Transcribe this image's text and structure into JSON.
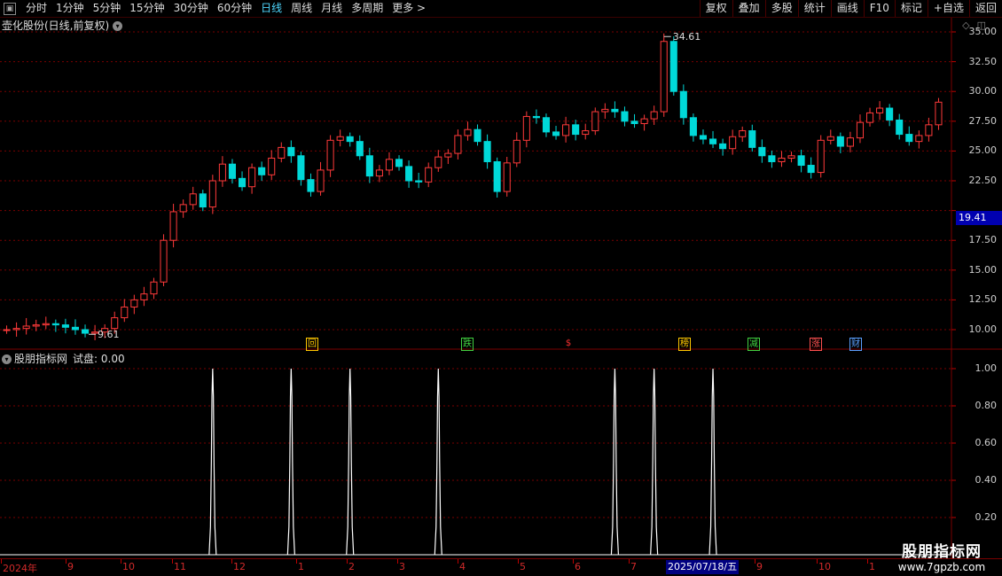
{
  "toolbar": {
    "menu_icon": "window-icon",
    "periods": [
      "分时",
      "1分钟",
      "5分钟",
      "15分钟",
      "30分钟",
      "60分钟",
      "日线",
      "周线",
      "月线",
      "多周期",
      "更多 >"
    ],
    "active_period": "日线",
    "actions": [
      "复权",
      "叠加",
      "多股",
      "统计",
      "画线",
      "F10",
      "标记",
      "+自选",
      "返回"
    ]
  },
  "main_panel": {
    "title": "壶化股份(日线,前复权)",
    "icons": [
      "diamond-icon",
      "panel-toggle-icon"
    ],
    "y_ticks": [
      "35.00",
      "32.50",
      "30.00",
      "27.50",
      "25.00",
      "22.50",
      "19.41",
      "17.50",
      "15.00",
      "12.50",
      "10.00"
    ],
    "current_price": "19.41",
    "high_label": "34.61",
    "low_label": "9.61",
    "markers": [
      {
        "text": "回",
        "color": "#ffc800",
        "border": "#ffc800"
      },
      {
        "text": "跌",
        "color": "#40d040",
        "border": "#40d040"
      },
      {
        "text": "$",
        "color": "#ff3030",
        "border": ""
      },
      {
        "text": "榜",
        "color": "#ffc800",
        "border": "#ffc800"
      },
      {
        "text": "减",
        "color": "#40d040",
        "border": "#40d040"
      },
      {
        "text": "涨",
        "color": "#ff5050",
        "border": "#ff5050"
      },
      {
        "text": "财",
        "color": "#5aa0ff",
        "border": "#5aa0ff"
      }
    ]
  },
  "indicator_panel": {
    "title": "股朋指标网",
    "trial_label": "试盘: 0.00",
    "y_ticks": [
      "1.00",
      "0.80",
      "0.60",
      "0.40",
      "0.20"
    ]
  },
  "date_axis": {
    "labels": [
      "2024年",
      "9",
      "10",
      "11",
      "12",
      "1",
      "2",
      "3",
      "4",
      "5",
      "6",
      "7",
      "9",
      "10",
      "1"
    ],
    "cursor_label": "2025/07/18/五"
  },
  "watermark": {
    "title": "股朋指标网",
    "url": "www.7gpzb.com"
  },
  "colors": {
    "up": "#ff3a3a",
    "down": "#00d8d8",
    "grid": "#7a0000",
    "accent": "#4fd8ff",
    "signal": "#ffffff"
  },
  "chart_data": [
    {
      "type": "candlestick",
      "title": "壶化股份(日线,前复权)",
      "ylim": [
        9.0,
        35.6
      ],
      "y_ticks": [
        10.0,
        12.5,
        15.0,
        17.5,
        20.0,
        22.5,
        25.0,
        27.5,
        30.0,
        32.5,
        35.0
      ],
      "series": [
        {
          "close": [
            10.0,
            10.1,
            10.3,
            10.4,
            10.5,
            10.4,
            10.2,
            10.0,
            9.7,
            9.8,
            10.1,
            11.0,
            11.9,
            12.5,
            13.0,
            14.0,
            17.5,
            19.9,
            20.5,
            21.4,
            20.3,
            22.5,
            23.9,
            22.7,
            22.0,
            23.6,
            23.0,
            24.4,
            25.3,
            24.6,
            22.6,
            21.6,
            23.4,
            25.9,
            26.2,
            25.8,
            24.6,
            22.9,
            23.4,
            24.3,
            23.7,
            22.5,
            22.4,
            23.6,
            24.5,
            24.8,
            26.3,
            26.8,
            25.8,
            24.1,
            21.6,
            24.0,
            25.9,
            27.9,
            27.8,
            26.6,
            26.3,
            27.2,
            26.4,
            26.7,
            28.3,
            28.5,
            28.3,
            27.5,
            27.3,
            27.7,
            28.3,
            34.2,
            30.0,
            27.8,
            26.3,
            26.0,
            25.6,
            25.2,
            26.2,
            26.7,
            25.3,
            24.6,
            24.1,
            24.4,
            24.6,
            23.8,
            23.2,
            25.9,
            26.2,
            25.4,
            26.1,
            27.4,
            28.2,
            28.6,
            27.6,
            26.4,
            25.8,
            26.3,
            27.2,
            29.1
          ]
        }
      ]
    },
    {
      "type": "line",
      "title": "股朋指标网",
      "ylim": [
        0,
        1.05
      ],
      "y_ticks": [
        0.2,
        0.4,
        0.6,
        0.8,
        1.0
      ],
      "series": [
        {
          "name": "试盘",
          "spikes_at": [
            21,
            29,
            35,
            44,
            62,
            66,
            72
          ],
          "values_at_spikes": [
            1.0,
            1.0,
            1.0,
            1.0,
            1.0,
            1.0,
            1.0
          ]
        }
      ]
    }
  ]
}
